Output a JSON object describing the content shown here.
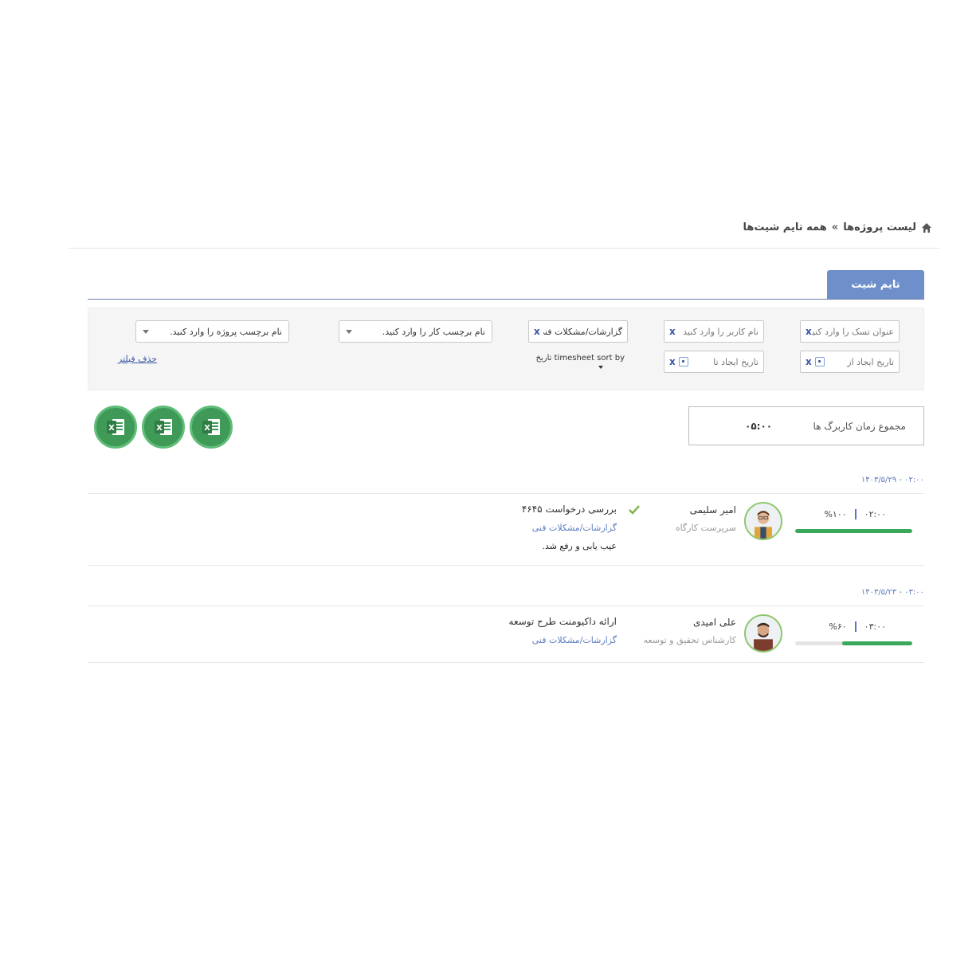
{
  "breadcrumb": {
    "project_list": "لیست پروژه‌ها",
    "separator": "»",
    "current": "همه تایم شیت‌ها"
  },
  "tab": {
    "label": "تایم شیت"
  },
  "filters": {
    "task_title_placeholder": "عنوان تسک را وارد کنید",
    "user_name_placeholder": "نام کاربر را وارد کنید",
    "tag_chip": "گزارشات/مشکلات فنی",
    "work_tag_placeholder": "نام برچسب کار را وارد کنید.",
    "project_tag_placeholder": "نام برچسب پروژه را وارد کنید.",
    "created_from_placeholder": "تاریخ ایجاد از",
    "created_to_placeholder": "تاریخ ایجاد تا",
    "clear_symbol": "x",
    "sort_by_label": "timesheet sort by تاریخ",
    "clear_filter_label": "حذف فیلتر"
  },
  "total": {
    "label": "مجموع زمان کاربرگ ها",
    "value": "۰۵:۰۰"
  },
  "groups": [
    {
      "date_label": "۰۲:۰۰ - ۱۴۰۳/۵/۲۹",
      "entries": [
        {
          "user_name": "امیر سلیمی",
          "user_role": "سرپرست کارگاه",
          "time": "۰۲:۰۰",
          "percent_label": "%۱۰۰",
          "progress": 1.0,
          "task_title": "بررسی درخواست ۴۶۴۵",
          "task_tag": "گزارشات/مشکلات فنی",
          "task_desc": "عیب یابی و رفع شد.",
          "approved": true
        }
      ]
    },
    {
      "date_label": "۰۳:۰۰ - ۱۴۰۳/۵/۲۳",
      "entries": [
        {
          "user_name": "علی امیدی",
          "user_role": "کارشناس تحقیق و توسعه",
          "time": "۰۳:۰۰",
          "percent_label": "%۶۰",
          "progress": 0.6,
          "task_title": "ارائه داکیومنت طرح توسعه",
          "task_tag": "گزارشات/مشکلات فنی",
          "approved": false
        }
      ]
    }
  ],
  "icons": {
    "home": "home-icon",
    "excel": "excel-icon",
    "calendar": "calendar-icon",
    "check": "check-icon",
    "avatar": "user-avatar"
  },
  "colors": {
    "accent": "#6f8fcb",
    "link": "#5c7bbf",
    "progress": "#3aa85a",
    "excel": "#3f9a58"
  }
}
